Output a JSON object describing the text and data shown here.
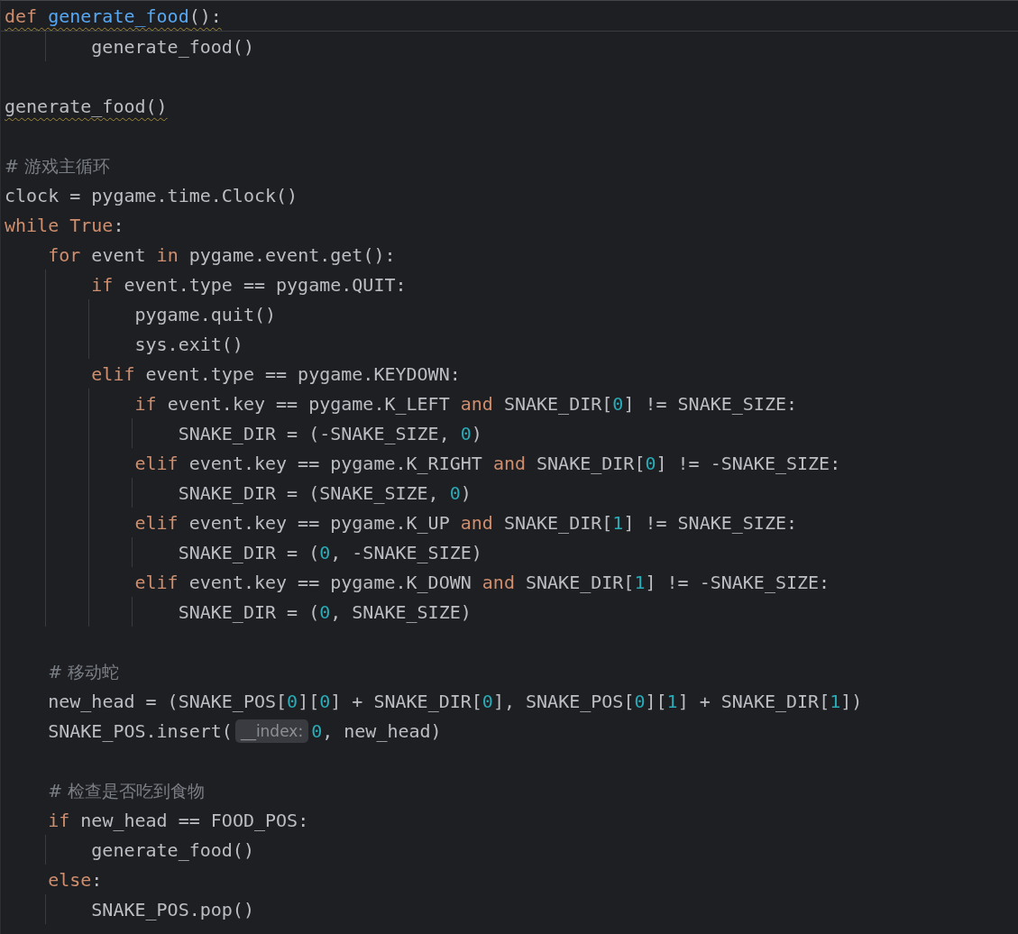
{
  "editor": {
    "sticky_header": {
      "kind": "code",
      "warning": true,
      "tokens": [
        {
          "kind": "keyword",
          "text": "def"
        },
        {
          "kind": "function",
          "text": " generate_food"
        },
        {
          "kind": "plain",
          "text": "():"
        }
      ]
    },
    "lines": [
      {
        "kind": "code",
        "warning": false,
        "tokens": [
          {
            "kind": "plain",
            "text": "        generate_food()"
          }
        ]
      },
      {
        "kind": "blank"
      },
      {
        "kind": "code",
        "warning": true,
        "tokens": [
          {
            "kind": "plain",
            "text": "generate_food()"
          }
        ]
      },
      {
        "kind": "blank"
      },
      {
        "kind": "code",
        "warning": false,
        "tokens": [
          {
            "kind": "comment",
            "text": "# 游戏主循环"
          }
        ]
      },
      {
        "kind": "code",
        "warning": false,
        "tokens": [
          {
            "kind": "plain",
            "text": "clock = pygame.time.Clock()"
          }
        ]
      },
      {
        "kind": "code",
        "warning": false,
        "tokens": [
          {
            "kind": "keyword",
            "text": "while True"
          },
          {
            "kind": "plain",
            "text": ":"
          }
        ]
      },
      {
        "kind": "code",
        "warning": false,
        "tokens": [
          {
            "kind": "keyword",
            "text": "    for"
          },
          {
            "kind": "plain",
            "text": " event "
          },
          {
            "kind": "keyword",
            "text": "in"
          },
          {
            "kind": "plain",
            "text": " pygame.event.get():"
          }
        ]
      },
      {
        "kind": "code",
        "warning": false,
        "tokens": [
          {
            "kind": "keyword",
            "text": "        if"
          },
          {
            "kind": "plain",
            "text": " event.type == pygame.QUIT:"
          }
        ]
      },
      {
        "kind": "code",
        "warning": false,
        "tokens": [
          {
            "kind": "plain",
            "text": "            pygame.quit()"
          }
        ]
      },
      {
        "kind": "code",
        "warning": false,
        "tokens": [
          {
            "kind": "plain",
            "text": "            sys.exit()"
          }
        ]
      },
      {
        "kind": "code",
        "warning": false,
        "tokens": [
          {
            "kind": "keyword",
            "text": "        elif"
          },
          {
            "kind": "plain",
            "text": " event.type == pygame.KEYDOWN:"
          }
        ]
      },
      {
        "kind": "code",
        "warning": false,
        "tokens": [
          {
            "kind": "keyword",
            "text": "            if"
          },
          {
            "kind": "plain",
            "text": " event.key == pygame.K_LEFT "
          },
          {
            "kind": "keyword",
            "text": "and"
          },
          {
            "kind": "plain",
            "text": " SNAKE_DIR["
          },
          {
            "kind": "number",
            "text": "0"
          },
          {
            "kind": "plain",
            "text": "] != SNAKE_SIZE:"
          }
        ]
      },
      {
        "kind": "code",
        "warning": false,
        "tokens": [
          {
            "kind": "plain",
            "text": "                SNAKE_DIR = (-SNAKE_SIZE, "
          },
          {
            "kind": "number",
            "text": "0"
          },
          {
            "kind": "plain",
            "text": ")"
          }
        ]
      },
      {
        "kind": "code",
        "warning": false,
        "tokens": [
          {
            "kind": "keyword",
            "text": "            elif"
          },
          {
            "kind": "plain",
            "text": " event.key == pygame.K_RIGHT "
          },
          {
            "kind": "keyword",
            "text": "and"
          },
          {
            "kind": "plain",
            "text": " SNAKE_DIR["
          },
          {
            "kind": "number",
            "text": "0"
          },
          {
            "kind": "plain",
            "text": "] != -SNAKE_SIZE:"
          }
        ]
      },
      {
        "kind": "code",
        "warning": false,
        "tokens": [
          {
            "kind": "plain",
            "text": "                SNAKE_DIR = (SNAKE_SIZE, "
          },
          {
            "kind": "number",
            "text": "0"
          },
          {
            "kind": "plain",
            "text": ")"
          }
        ]
      },
      {
        "kind": "code",
        "warning": false,
        "tokens": [
          {
            "kind": "keyword",
            "text": "            elif"
          },
          {
            "kind": "plain",
            "text": " event.key == pygame.K_UP "
          },
          {
            "kind": "keyword",
            "text": "and"
          },
          {
            "kind": "plain",
            "text": " SNAKE_DIR["
          },
          {
            "kind": "number",
            "text": "1"
          },
          {
            "kind": "plain",
            "text": "] != SNAKE_SIZE:"
          }
        ]
      },
      {
        "kind": "code",
        "warning": false,
        "tokens": [
          {
            "kind": "plain",
            "text": "                SNAKE_DIR = ("
          },
          {
            "kind": "number",
            "text": "0"
          },
          {
            "kind": "plain",
            "text": ", -SNAKE_SIZE)"
          }
        ]
      },
      {
        "kind": "code",
        "warning": false,
        "tokens": [
          {
            "kind": "keyword",
            "text": "            elif"
          },
          {
            "kind": "plain",
            "text": " event.key == pygame.K_DOWN "
          },
          {
            "kind": "keyword",
            "text": "and"
          },
          {
            "kind": "plain",
            "text": " SNAKE_DIR["
          },
          {
            "kind": "number",
            "text": "1"
          },
          {
            "kind": "plain",
            "text": "] != -SNAKE_SIZE:"
          }
        ]
      },
      {
        "kind": "code",
        "warning": false,
        "tokens": [
          {
            "kind": "plain",
            "text": "                SNAKE_DIR = ("
          },
          {
            "kind": "number",
            "text": "0"
          },
          {
            "kind": "plain",
            "text": ", SNAKE_SIZE)"
          }
        ]
      },
      {
        "kind": "blank"
      },
      {
        "kind": "code",
        "warning": false,
        "tokens": [
          {
            "kind": "comment",
            "text": "    # 移动蛇"
          }
        ]
      },
      {
        "kind": "code",
        "warning": false,
        "tokens": [
          {
            "kind": "plain",
            "text": "    new_head = (SNAKE_POS["
          },
          {
            "kind": "number",
            "text": "0"
          },
          {
            "kind": "plain",
            "text": "]["
          },
          {
            "kind": "number",
            "text": "0"
          },
          {
            "kind": "plain",
            "text": "] + SNAKE_DIR["
          },
          {
            "kind": "number",
            "text": "0"
          },
          {
            "kind": "plain",
            "text": "], SNAKE_POS["
          },
          {
            "kind": "number",
            "text": "0"
          },
          {
            "kind": "plain",
            "text": "]["
          },
          {
            "kind": "number",
            "text": "1"
          },
          {
            "kind": "plain",
            "text": "] + SNAKE_DIR["
          },
          {
            "kind": "number",
            "text": "1"
          },
          {
            "kind": "plain",
            "text": "])"
          }
        ]
      },
      {
        "kind": "code",
        "warning": false,
        "tokens": [
          {
            "kind": "plain",
            "text": "    SNAKE_POS.insert("
          },
          {
            "kind": "hint",
            "text": "__index:"
          },
          {
            "kind": "number",
            "text": "0"
          },
          {
            "kind": "plain",
            "text": ", new_head)"
          }
        ]
      },
      {
        "kind": "blank"
      },
      {
        "kind": "code",
        "warning": false,
        "tokens": [
          {
            "kind": "comment",
            "text": "    # 检查是否吃到食物"
          }
        ]
      },
      {
        "kind": "code",
        "warning": false,
        "tokens": [
          {
            "kind": "keyword",
            "text": "    if"
          },
          {
            "kind": "plain",
            "text": " new_head == FOOD_POS:"
          }
        ]
      },
      {
        "kind": "code",
        "warning": false,
        "tokens": [
          {
            "kind": "plain",
            "text": "        generate_food()"
          }
        ]
      },
      {
        "kind": "code",
        "warning": false,
        "tokens": [
          {
            "kind": "keyword",
            "text": "    else"
          },
          {
            "kind": "plain",
            "text": ":"
          }
        ]
      },
      {
        "kind": "code",
        "warning": false,
        "tokens": [
          {
            "kind": "plain",
            "text": "        SNAKE_POS.pop()"
          }
        ]
      }
    ]
  }
}
